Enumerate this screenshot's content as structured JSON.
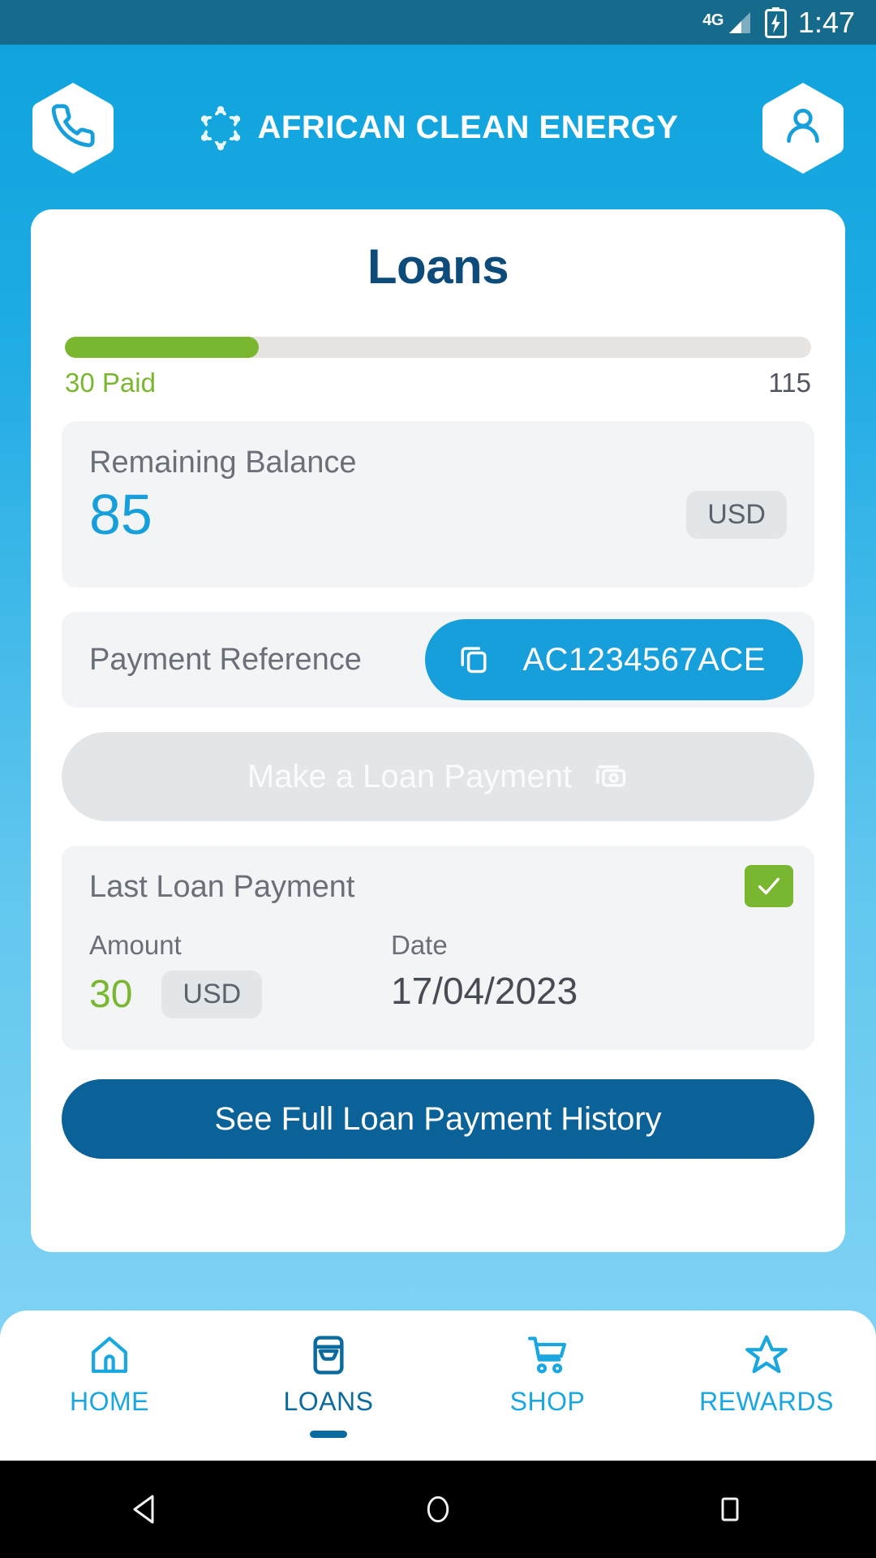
{
  "status_bar": {
    "network": "4G",
    "time": "1:47",
    "battery_icon": "battery-charging-icon",
    "signal_icon": "signal-bars-icon"
  },
  "header": {
    "call_icon": "phone-icon",
    "profile_icon": "person-icon",
    "brand_mark_icon": "african-clean-energy-logo-icon",
    "brand_name": "AFRICAN CLEAN ENERGY"
  },
  "main": {
    "title": "Loans",
    "progress": {
      "paid_label": "30 Paid",
      "total_label": "115",
      "paid": 30,
      "total": 115,
      "percent": 26
    },
    "balance": {
      "label": "Remaining Balance",
      "value": "85",
      "currency": "USD"
    },
    "payment_reference": {
      "label": "Payment Reference",
      "code": "AC1234567ACE",
      "copy_icon": "copy-icon"
    },
    "make_payment": {
      "label": "Make a Loan Payment",
      "icon": "banknote-icon",
      "disabled": true
    },
    "last_payment": {
      "title": "Last Loan Payment",
      "status_icon": "check-icon",
      "amount_label": "Amount",
      "amount_value": "30",
      "amount_currency": "USD",
      "date_label": "Date",
      "date_value": "17/04/2023"
    },
    "history_button": {
      "label": "See Full Loan Payment History"
    }
  },
  "bottom_nav": {
    "items": [
      {
        "label": "HOME",
        "icon": "home-icon",
        "active": false
      },
      {
        "label": "LOANS",
        "icon": "wallet-icon",
        "active": true
      },
      {
        "label": "SHOP",
        "icon": "cart-icon",
        "active": false
      },
      {
        "label": "REWARDS",
        "icon": "star-icon",
        "active": false
      }
    ]
  },
  "system_nav": {
    "back_icon": "back-triangle-icon",
    "home_icon": "home-circle-icon",
    "recents_icon": "recents-square-icon"
  },
  "colors": {
    "brand_blue": "#169fdb",
    "dark_blue": "#0a6298",
    "navy": "#0d4b7a",
    "green": "#7ab730",
    "panel_grey": "#f2f4f5",
    "badge_grey": "#e3e6e9"
  }
}
